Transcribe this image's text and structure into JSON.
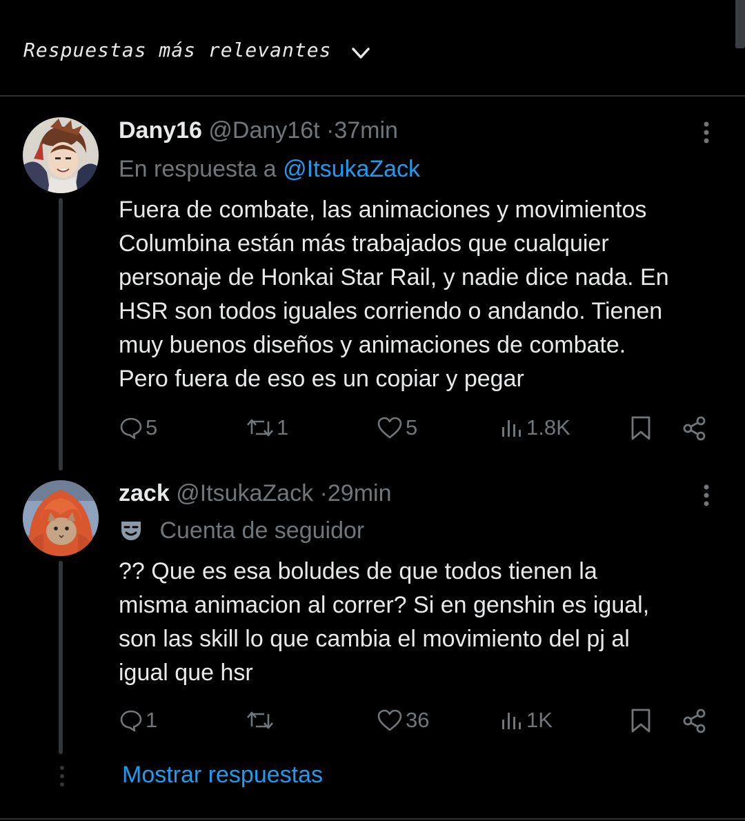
{
  "header": {
    "sort_label": "Respuestas más relevantes",
    "chevron_icon": "chevron-down-icon"
  },
  "colors": {
    "background": "#000000",
    "text": "#e7e9ea",
    "muted": "#71767b",
    "accent": "#1d9bf0",
    "divider": "#2f3336"
  },
  "replies": [
    {
      "name": "Dany16",
      "handle": "@Dany16t",
      "separator": "·",
      "time": "37min",
      "reply_prefix": "En respuesta a ",
      "reply_to": "@ItsukaZack",
      "lines": [
        "Fuera de combate, las animaciones y movimientos",
        "Columbina están más trabajados que cualquier",
        "personaje de Honkai Star Rail, y nadie dice nada. En",
        "HSR son todos iguales corriendo o andando. Tienen",
        "muy buenos diseños y animaciones de combate.",
        "Pero fuera de eso es un copiar y pegar"
      ],
      "stats": {
        "replies": "5",
        "reposts": "1",
        "likes": "5",
        "views": "1.8K"
      }
    },
    {
      "name": "zack",
      "handle": "@ItsukaZack",
      "separator": "·",
      "time": "29min",
      "badge_icon": "theater-mask-icon",
      "badge_label": "Cuenta de seguidor",
      "lines": [
        "?? Que es esa boludes de que todos tienen la",
        "misma animacion al correr? Si en genshin es igual,",
        "son las skill lo que cambia el movimiento del pj al",
        "igual que hsr"
      ],
      "stats": {
        "replies": "1",
        "reposts": "",
        "likes": "36",
        "views": "1K"
      }
    }
  ],
  "show_replies": "Mostrar respuestas"
}
